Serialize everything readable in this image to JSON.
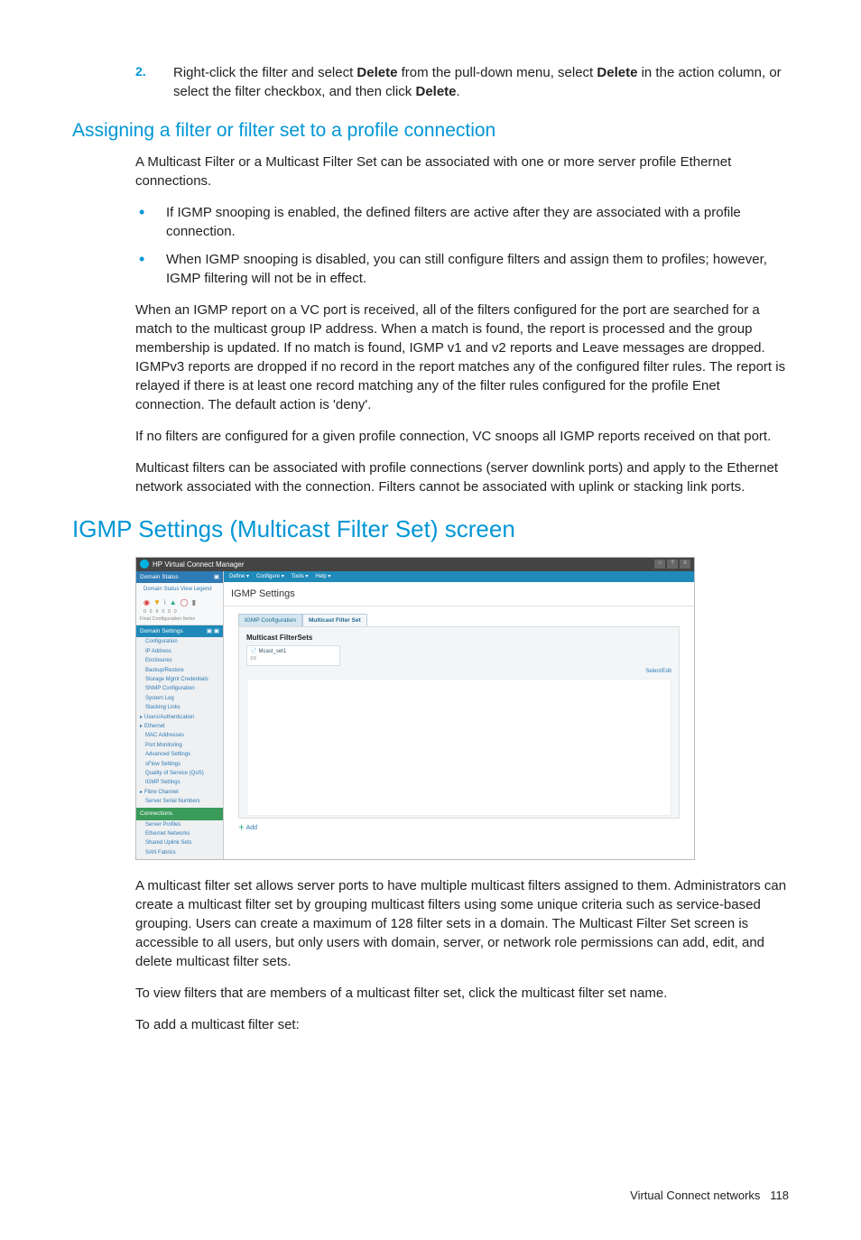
{
  "step": {
    "number": "2.",
    "text_before_b1": "Right-click the filter and select ",
    "b1": "Delete",
    "text_mid1": " from the pull-down menu, select ",
    "b2": "Delete",
    "text_mid2": " in the action column, or select the filter checkbox, and then click ",
    "b3": "Delete",
    "text_after": "."
  },
  "h2_assign": "Assigning a filter or filter set to a profile connection",
  "assign_intro": "A Multicast Filter or a Multicast Filter Set can be associated with one or more server profile Ethernet connections.",
  "assign_bullets": [
    "If IGMP snooping is enabled, the defined filters are active after they are associated with a profile connection.",
    "When IGMP snooping is disabled, you can still configure filters and assign them to profiles; however, IGMP filtering will not be in effect."
  ],
  "assign_p2": "When an IGMP report on a VC port is received, all of the filters configured for the port are searched for a match to the multicast group IP address. When a match is found, the report is processed and the group membership is updated. If no match is found, IGMP v1 and v2 reports and Leave messages are dropped. IGMPv3 reports are dropped if no record in the report matches any of the configured filter rules. The report is relayed if there is at least one record matching any of the filter rules configured for the profile Enet connection. The default action is 'deny'.",
  "assign_p3": "If no filters are configured for a given profile connection, VC snoops all IGMP reports received on that port.",
  "assign_p4": "Multicast filters can be associated with profile connections (server downlink ports) and apply to the Ethernet network associated with the connection. Filters cannot be associated with uplink or stacking link ports.",
  "h1_igmp": "IGMP Settings (Multicast Filter Set) screen",
  "ss": {
    "app_title": "HP Virtual Connect Manager",
    "top_btns": [
      "⌂",
      "?",
      "≡"
    ],
    "sidebar": {
      "domain_status_hdr": "Domain Status",
      "domain_status_links": "Domain Status   View Legend",
      "config_items_label": "Final Configuration Items",
      "domain_settings_hdr": "Domain Settings",
      "items1": [
        "Configuration",
        "IP Address",
        "Enclosures",
        "Backup/Restore",
        "Storage Mgmt Credentials",
        "SNMP Configuration",
        "System Log",
        "Stacking Links"
      ],
      "group_users": "Users/Authentication",
      "group_eth": "Ethernet",
      "items_eth": [
        "MAC Addresses",
        "Port Monitoring",
        "Advanced Settings",
        "sFlow Settings",
        "Quality of Service (QoS)",
        "IGMP Settings"
      ],
      "group_fc": "Fibre Channel",
      "item_fc": "Server Serial Numbers",
      "connections_hdr": "Connections",
      "items_conn": [
        "Server Profiles",
        "Ethernet Networks",
        "Shared Uplink Sets",
        "SAN Fabrics"
      ]
    },
    "menubar": [
      "Define ▾",
      "Configure ▾",
      "Tools ▾",
      "Help ▾"
    ],
    "page_title": "IGMP Settings",
    "tabs": [
      "IGMP Configuration",
      "Multicast Filter Set"
    ],
    "panel_title": "Multicast FilterSets",
    "filter_item": {
      "name": "Mcast_set1",
      "sub": "≡≡",
      "action": "Select/Edit"
    },
    "add_label": "Add"
  },
  "after_ss_p1": "A multicast filter set allows server ports to have multiple multicast filters assigned to them. Administrators can create a multicast filter set by grouping multicast filters using some unique criteria such as service-based grouping. Users can create a maximum of 128 filter sets in a domain. The Multicast Filter Set screen is accessible to all users, but only users with domain, server, or network role permissions can add, edit, and delete multicast filter sets.",
  "after_ss_p2": "To view filters that are members of a multicast filter set, click the multicast filter set name.",
  "after_ss_p3": "To add a multicast filter set:",
  "footer": {
    "section": "Virtual Connect networks",
    "page": "118"
  }
}
